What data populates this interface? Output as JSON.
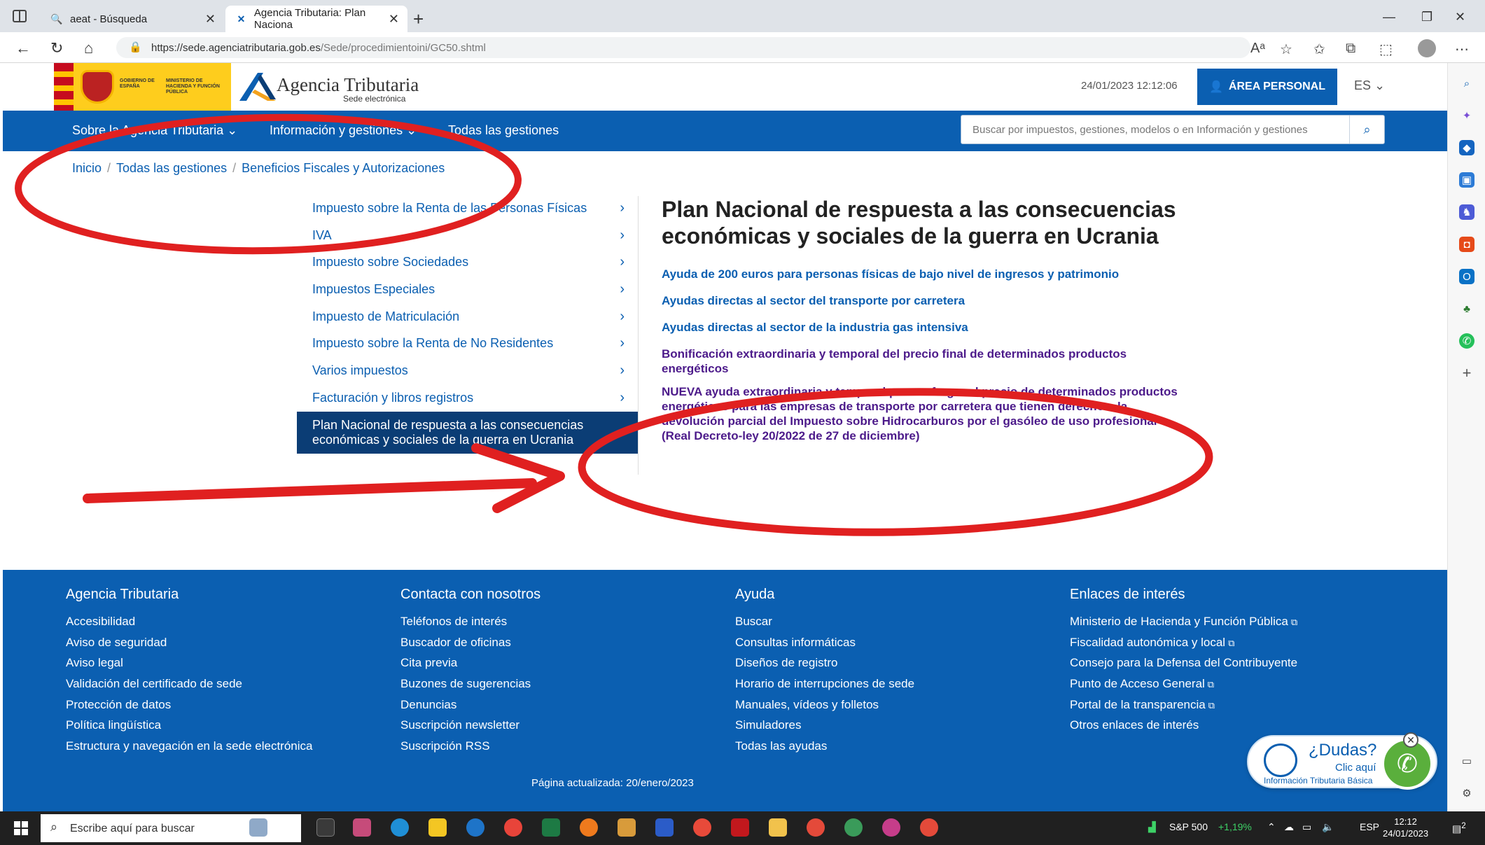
{
  "browser": {
    "tabs": [
      {
        "label": "aeat - Búsqueda"
      },
      {
        "label": "Agencia Tributaria: Plan Naciona"
      }
    ],
    "url_host": "https://sede.agenciatributaria.gob.es",
    "url_path": "/Sede/procedimientoini/GC50.shtml"
  },
  "header": {
    "gov_line1": "Gobierno de España",
    "gov_line2": "Ministerio de Hacienda y Función Pública",
    "brand_title": "Agencia Tributaria",
    "brand_sub": "Sede electrónica",
    "datetime": "24/01/2023 12:12:06",
    "area_personal": "ÁREA PERSONAL",
    "lang": "ES"
  },
  "nav": {
    "items": [
      {
        "label": "Sobre la Agencia Tributaria"
      },
      {
        "label": "Información y gestiones"
      },
      {
        "label": "Todas las gestiones"
      }
    ],
    "search_placeholder": "Buscar por impuestos, gestiones, modelos o en Información y gestiones"
  },
  "breadcrumb": [
    "Inicio",
    "Todas las gestiones",
    "Beneficios Fiscales y Autorizaciones"
  ],
  "menu": [
    "Impuesto sobre la Renta de las Personas Físicas",
    "IVA",
    "Impuesto sobre Sociedades",
    "Impuestos Especiales",
    "Impuesto de Matriculación",
    "Impuesto sobre la Renta de No Residentes",
    "Varios impuestos",
    "Facturación y libros registros",
    "Plan Nacional de respuesta a las consecuencias económicas y sociales de la guerra en Ucrania"
  ],
  "main": {
    "title": "Plan Nacional de respuesta a las consecuencias económicas y sociales de la guerra en Ucrania",
    "links": [
      "Ayuda de 200 euros para personas físicas de bajo nivel de ingresos y patrimonio",
      "Ayudas directas al sector del transporte por carretera",
      "Ayudas directas al sector de la industria gas intensiva",
      "Bonificación extraordinaria y temporal del precio final de determinados productos energéticos",
      "NUEVA ayuda extraordinaria y temporal para sufragar el precio de determinados productos energéticos para las empresas de transporte por carretera que tienen derecho a la devolución parcial del Impuesto sobre Hidrocarburos por el gasóleo de uso profesional (Real Decreto-ley 20/2022 de 27 de diciembre)"
    ]
  },
  "footer": {
    "cols": [
      {
        "title": "Agencia Tributaria",
        "items": [
          "Accesibilidad",
          "Aviso de seguridad",
          "Aviso legal",
          "Validación del certificado de sede",
          "Protección de datos",
          "Política lingüística",
          "Estructura y navegación en la sede electrónica"
        ]
      },
      {
        "title": "Contacta con nosotros",
        "items": [
          "Teléfonos de interés",
          "Buscador de oficinas",
          "Cita previa",
          "Buzones de sugerencias",
          "Denuncias",
          "Suscripción newsletter",
          "Suscripción RSS"
        ]
      },
      {
        "title": "Ayuda",
        "items": [
          "Buscar",
          "Consultas informáticas",
          "Diseños de registro",
          "Horario de interrupciones de sede",
          "Manuales, vídeos y folletos",
          "Simuladores",
          "Todas las ayudas"
        ]
      },
      {
        "title": "Enlaces de interés",
        "items": [
          "Ministerio de Hacienda y Función Pública",
          "Fiscalidad autonómica y local",
          "Consejo para la Defensa del Contribuyente",
          "Punto de Acceso General",
          "Portal de la transparencia",
          "Otros enlaces de interés"
        ]
      }
    ],
    "updated": "Página actualizada: 20/enero/2023"
  },
  "dudas": {
    "title": "¿Dudas?",
    "click": "Clic aquí",
    "info": "Información Tributaria Básica"
  },
  "taskbar": {
    "search_placeholder": "Escribe aquí para buscar",
    "stock_name": "S&P 500",
    "stock_change": "+1,19%",
    "lang": "ESP",
    "time": "12:12",
    "date": "24/01/2023",
    "notifications": "2"
  },
  "colors": {
    "brand_blue": "#0b5fb1",
    "dark_blue": "#0b3d75",
    "annotation_red": "#e02020",
    "visited": "#4c1a8a"
  }
}
